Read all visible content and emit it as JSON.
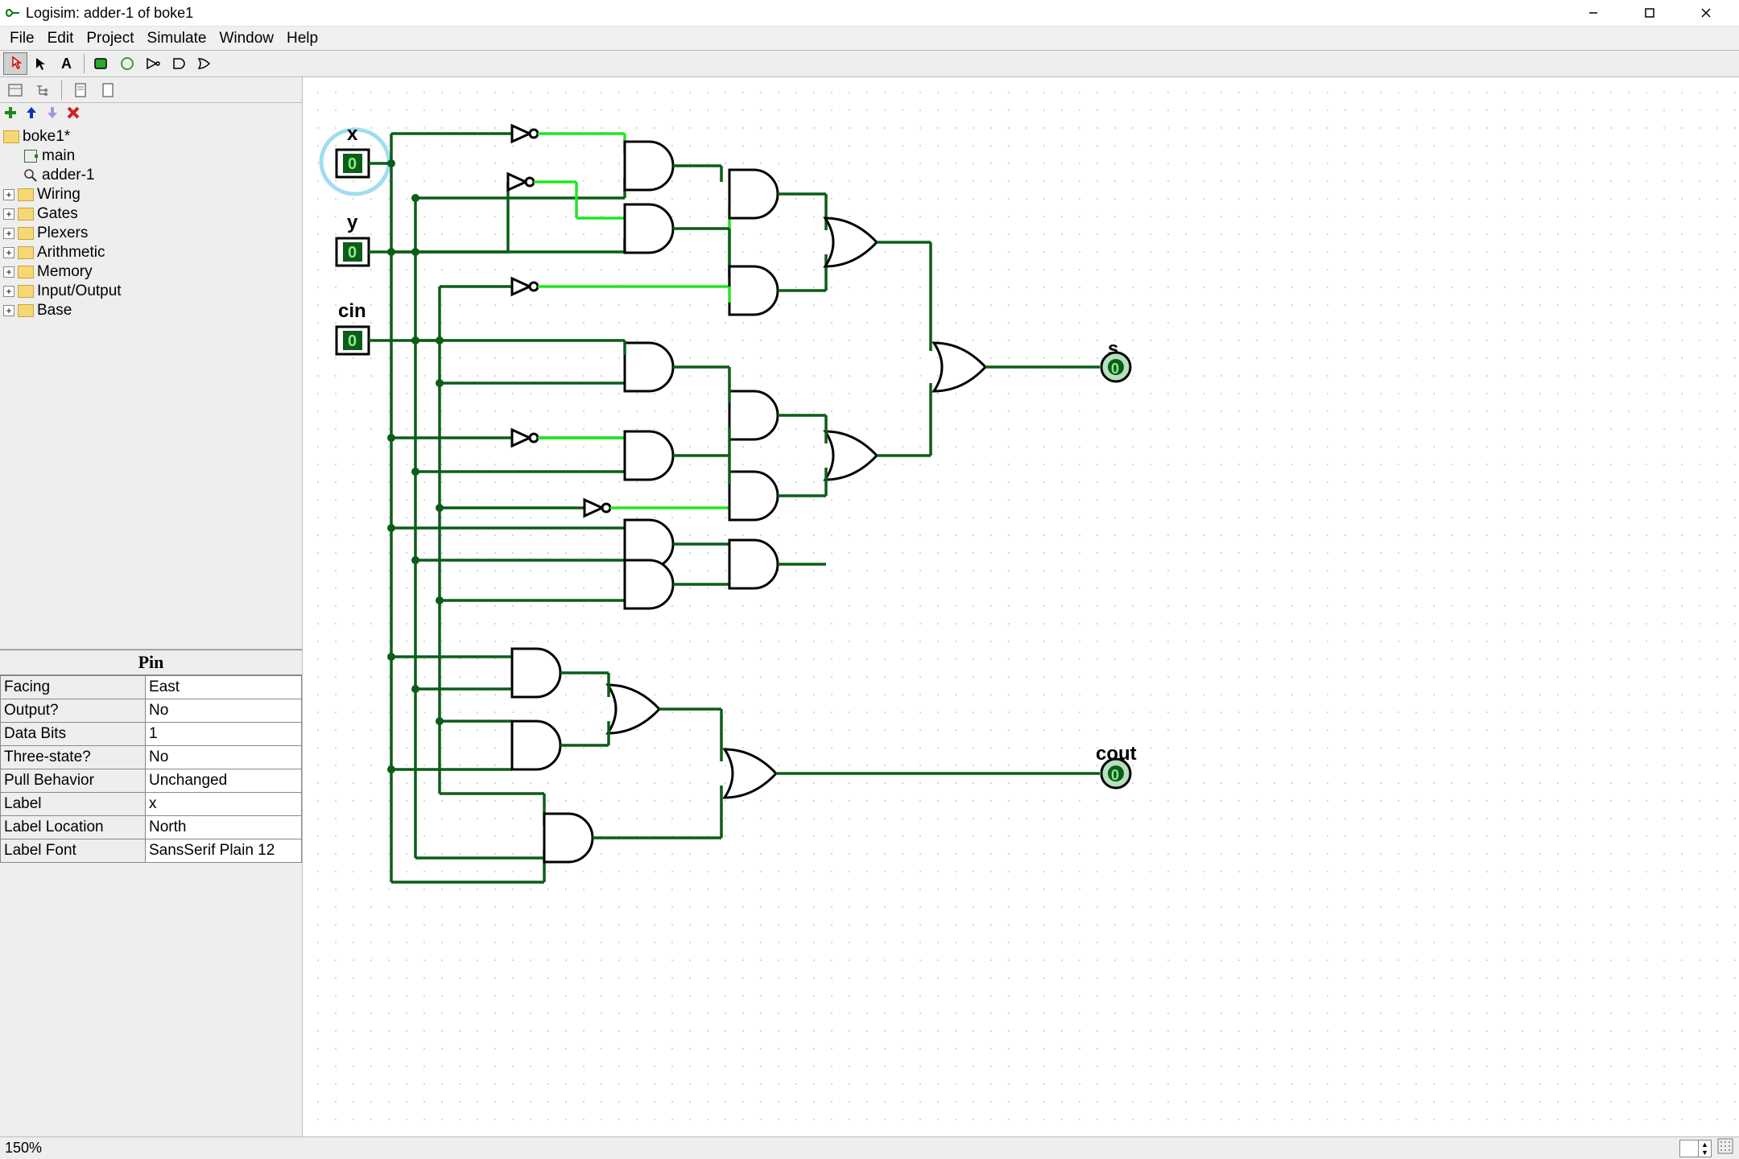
{
  "window": {
    "title": "Logisim: adder-1 of boke1"
  },
  "menu": {
    "file": "File",
    "edit": "Edit",
    "project": "Project",
    "simulate": "Simulate",
    "window": "Window",
    "help": "Help"
  },
  "tree": {
    "root": "boke1*",
    "main": "main",
    "adder": "adder-1",
    "libs": {
      "wiring": "Wiring",
      "gates": "Gates",
      "plexers": "Plexers",
      "arithmetic": "Arithmetic",
      "memory": "Memory",
      "io": "Input/Output",
      "base": "Base"
    }
  },
  "props": {
    "title": "Pin",
    "rows": [
      {
        "k": "Facing",
        "v": "East"
      },
      {
        "k": "Output?",
        "v": "No"
      },
      {
        "k": "Data Bits",
        "v": "1"
      },
      {
        "k": "Three-state?",
        "v": "No"
      },
      {
        "k": "Pull Behavior",
        "v": "Unchanged"
      },
      {
        "k": "Label",
        "v": "x"
      },
      {
        "k": "Label Location",
        "v": "North"
      },
      {
        "k": "Label Font",
        "v": "SansSerif Plain 12"
      }
    ]
  },
  "status": {
    "zoom": "150%"
  },
  "circuit": {
    "inputs": {
      "x": "x",
      "y": "y",
      "cin": "cin"
    },
    "outputs": {
      "s": "s",
      "cout": "cout"
    },
    "pin_value": "0"
  }
}
